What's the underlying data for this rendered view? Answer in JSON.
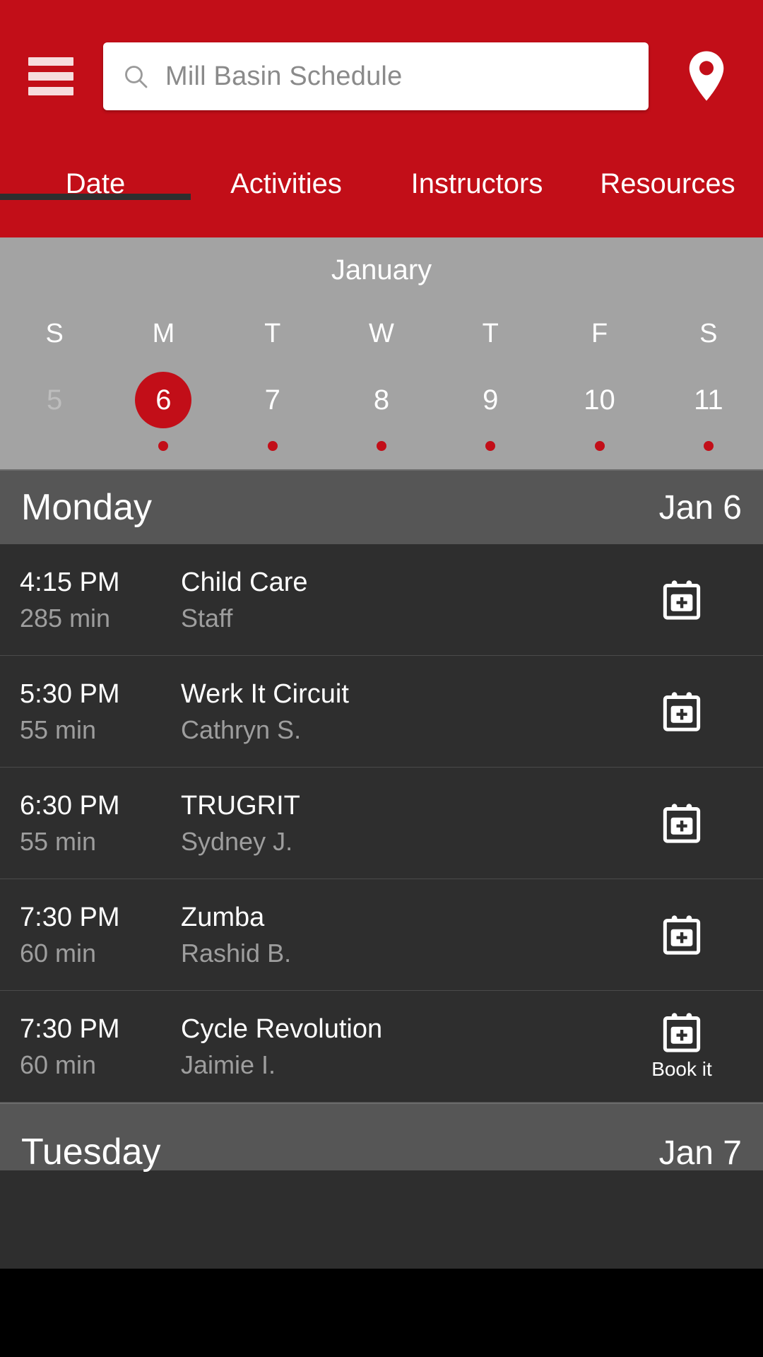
{
  "colors": {
    "brand_red": "#C20E18",
    "calendar_strip": "#a3a3a3",
    "day_header": "#565656",
    "list_bg": "#2e2e2e",
    "bottom_bar": "#000000"
  },
  "appbar": {
    "menu_icon": "hamburger-menu-icon",
    "location_icon": "location-pin-icon",
    "search": {
      "icon": "search-icon",
      "value": "",
      "placeholder": "Mill Basin Schedule"
    }
  },
  "tabs": [
    {
      "label": "Date",
      "active": true
    },
    {
      "label": "Activities",
      "active": false
    },
    {
      "label": "Instructors",
      "active": false
    },
    {
      "label": "Resources",
      "active": false
    }
  ],
  "calendar": {
    "month": "January",
    "days": [
      {
        "dow": "S",
        "date": "5",
        "selected": false,
        "dim": true,
        "has_dot": false
      },
      {
        "dow": "M",
        "date": "6",
        "selected": true,
        "dim": false,
        "has_dot": true
      },
      {
        "dow": "T",
        "date": "7",
        "selected": false,
        "dim": false,
        "has_dot": true
      },
      {
        "dow": "W",
        "date": "8",
        "selected": false,
        "dim": false,
        "has_dot": true
      },
      {
        "dow": "T",
        "date": "9",
        "selected": false,
        "dim": false,
        "has_dot": true
      },
      {
        "dow": "F",
        "date": "10",
        "selected": false,
        "dim": false,
        "has_dot": true
      },
      {
        "dow": "S",
        "date": "11",
        "selected": false,
        "dim": false,
        "has_dot": true
      }
    ]
  },
  "day_sections": [
    {
      "dayname": "Monday",
      "daydate": "Jan 6",
      "classes": [
        {
          "time": "4:15 PM",
          "duration": "285 min",
          "title": "Child Care",
          "instructor": "Staff",
          "action_icon": "calendar-plus-icon",
          "action_label": ""
        },
        {
          "time": "5:30 PM",
          "duration": "55 min",
          "title": "Werk It Circuit",
          "instructor": "Cathryn S.",
          "action_icon": "calendar-plus-icon",
          "action_label": ""
        },
        {
          "time": "6:30 PM",
          "duration": "55 min",
          "title": "TRUGRIT",
          "instructor": "Sydney J.",
          "action_icon": "calendar-plus-icon",
          "action_label": ""
        },
        {
          "time": "7:30 PM",
          "duration": "60 min",
          "title": "Zumba",
          "instructor": "Rashid B.",
          "action_icon": "calendar-plus-icon",
          "action_label": ""
        },
        {
          "time": "7:30 PM",
          "duration": "60 min",
          "title": "Cycle Revolution",
          "instructor": "Jaimie I.",
          "action_icon": "calendar-plus-icon",
          "action_label": "Book it"
        }
      ]
    },
    {
      "dayname": "Tuesday",
      "daydate": "Jan 7",
      "classes": []
    }
  ]
}
